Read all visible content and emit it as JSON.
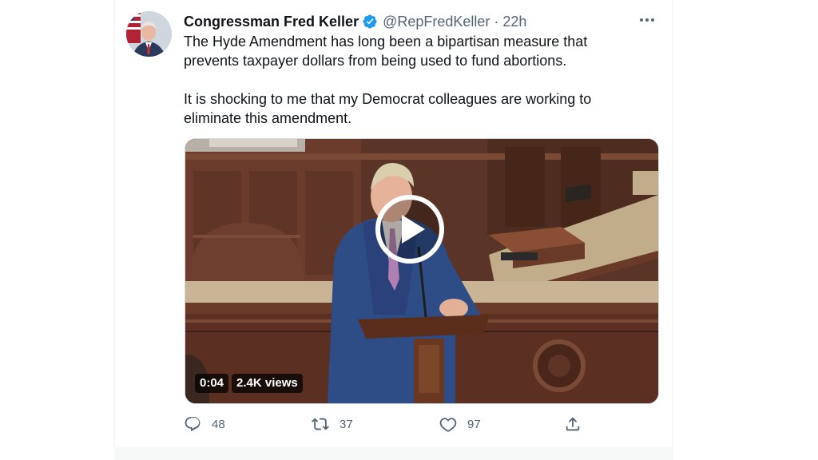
{
  "tweet": {
    "display_name": "Congressman Fred Keller",
    "handle": "@RepFredKeller",
    "separator": "·",
    "time": "22h",
    "text_paragraphs": [
      "The Hyde Amendment has long been a bipartisan measure that\nprevents taxpayer dollars from being used to fund abortions.",
      "It is shocking to me that my Democrat colleagues are working to\neliminate this amendment."
    ],
    "video": {
      "duration": "0:04",
      "views": "2.4K views"
    },
    "actions": {
      "replies": "48",
      "retweets": "37",
      "likes": "97"
    }
  },
  "icons": {
    "verified": "verified-badge-icon",
    "more": "more-options-icon",
    "reply": "reply-icon",
    "retweet": "retweet-icon",
    "like": "heart-icon",
    "share": "share-icon",
    "play": "play-icon"
  },
  "colors": {
    "verified_blue": "#1d9bf0",
    "secondary_text": "#536471",
    "primary_text": "#0f1419"
  }
}
